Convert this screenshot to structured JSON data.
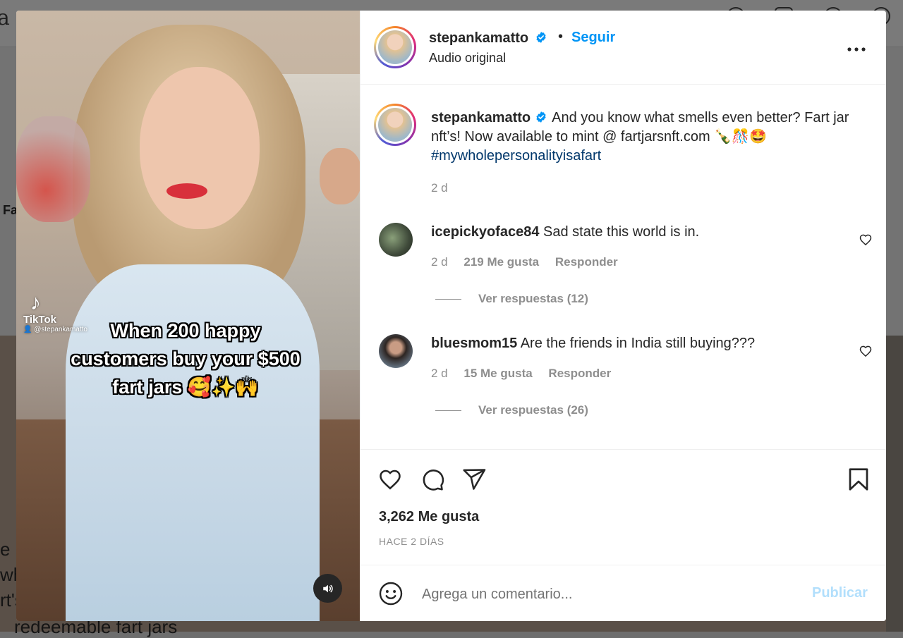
{
  "post": {
    "username": "stepankamatto",
    "follow_label": "Seguir",
    "separator": "•",
    "audio_label": "Audio original",
    "caption_text": "And you know what smells even better? Fart jar nft’s! Now available to mint @ fartjarsnft.com 🍾🎊🤩",
    "hashtag": "#mywholepersonalityisafart",
    "caption_time": "2 d",
    "likes": "3,262 Me gusta",
    "time_ago": "HACE 2 DÍAS"
  },
  "video": {
    "tiktok_label": "TikTok",
    "tiktok_handle": "👤 @stepankamatto",
    "overlay_line1": "When 200 happy",
    "overlay_line2": "customers buy your $500",
    "overlay_line3": "fart jars 🥰✨🙌"
  },
  "comments": [
    {
      "username": "icepickyoface84",
      "text": "Sad state this world is in.",
      "time": "2 d",
      "likes": "219 Me gusta",
      "reply_label": "Responder",
      "view_replies": "Ver respuestas (12)"
    },
    {
      "username": "bluesmom15",
      "text": "Are the friends in India still buying???",
      "time": "2 d",
      "likes": "15 Me gusta",
      "reply_label": "Responder",
      "view_replies": "Ver respuestas (26)"
    }
  ],
  "composer": {
    "placeholder": "Agrega un comentario...",
    "publish_label": "Publicar"
  },
  "background": {
    "text_1": "e",
    "text_2": "wh",
    "text_3": "rt's",
    "text_4": "redeemable fart jars",
    "text_5": "Fa"
  },
  "colors": {
    "accent": "#0095f6",
    "hashtag": "#00376b",
    "muted": "#8e8e8e",
    "publish_disabled": "#b2dffc"
  },
  "icons": [
    "heart-icon",
    "comment-icon",
    "share-icon",
    "bookmark-icon",
    "emoji-icon",
    "more-icon",
    "verified-icon",
    "volume-icon",
    "tiktok-icon"
  ]
}
